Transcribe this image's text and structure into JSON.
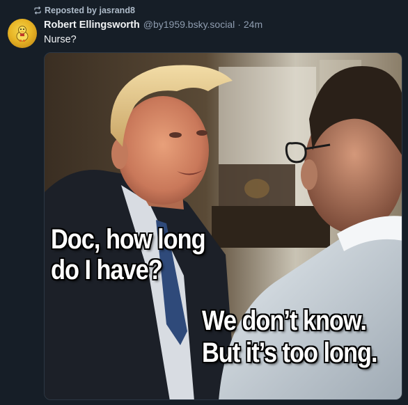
{
  "repost": {
    "label": "Reposted by jasrand8",
    "icon": "repost-icon"
  },
  "author": {
    "name": "Robert Ellingsworth",
    "handle": "@by1959.bsky.social",
    "separator": "·",
    "time": "24m"
  },
  "post": {
    "text": "Nurse?"
  },
  "media": {
    "caption_patient": [
      "Doc, how long",
      "do I have?"
    ],
    "caption_doctor": [
      "We don’t know.",
      "But it’s too long."
    ]
  },
  "colors": {
    "background": "#161e27",
    "primary_text": "#f1f3f5",
    "muted_text": "#8f9db0"
  }
}
